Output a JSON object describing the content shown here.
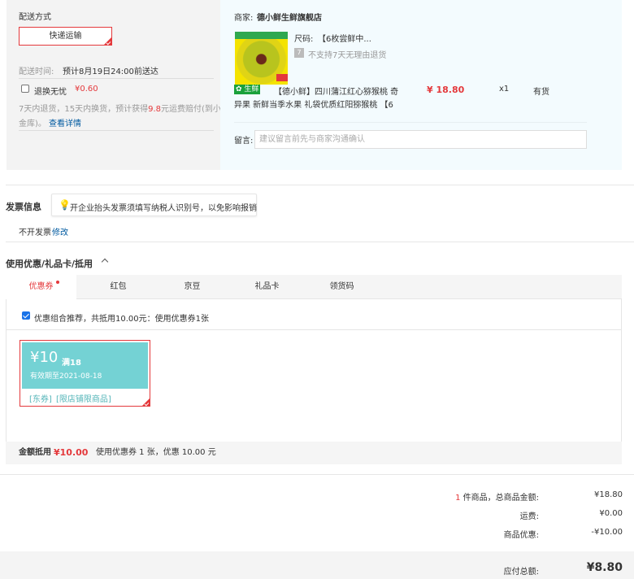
{
  "shipping": {
    "title": "配送方式",
    "method_label": "快递运输",
    "time_label": "配送时间:",
    "time_value": "预计8月19日24:00前送达",
    "worry_free_label": "退换无忧",
    "worry_free_price": "¥0.60",
    "worry_free_desc_1": "7天内退货，15天内换货，预计获得",
    "worry_free_desc_highlight": "9.8",
    "worry_free_desc_2": "元运费赔付(到小",
    "worry_free_desc_3": "金库)。",
    "view_details": "查看详情"
  },
  "shop": {
    "merchant_label": "商家:",
    "merchant_name": "德小鲜生鲜旗舰店",
    "size_label": "尺码:",
    "size_value": "【6枚尝鲜中...",
    "no_return_badge": "7",
    "no_return_text": "不支持7天无理由退货",
    "badge": "生鲜",
    "product_title_1": "【德小鲜】四川蒲江红心猕猴桃 奇",
    "product_title_2": "异果 新鲜当季水果 礼袋优质红阳猕猴桃 【6",
    "price": "¥ 18.80",
    "quantity": "x1",
    "stock": "有货",
    "note_label": "留言:",
    "note_placeholder": "建议留言前先与商家沟通确认"
  },
  "invoice": {
    "title": "发票信息",
    "tip": "开企业抬头发票须填写纳税人识别号，以免影响报销",
    "status": "不开发票",
    "modify": "修改"
  },
  "discount": {
    "title": "使用优惠/礼品卡/抵用",
    "tabs": [
      "优惠券",
      "红包",
      "京豆",
      "礼品卡",
      "领货码"
    ],
    "combo_text": "优惠组合推荐，共抵用10.00元：使用优惠券1张",
    "coupon": {
      "amount": "¥10",
      "condition": "满18",
      "validity": "有效期至2021-08-18",
      "tag1": "[东券]",
      "tag2": "[限店铺限商品]"
    },
    "deduct_label": "金额抵用",
    "deduct_value": "¥10.00",
    "deduct_desc": "使用优惠券 1 张，优惠 10.00 元"
  },
  "summary": {
    "count": "1",
    "goods_label": "件商品，总商品金额:",
    "goods_value": "¥18.80",
    "freight_label": "运费:",
    "freight_value": "¥0.00",
    "discount_label": "商品优惠:",
    "discount_value": "-¥10.00",
    "total_label": "应付总额:",
    "total_value": "¥8.80"
  },
  "colors": {
    "accent": "#e4393c",
    "coupon": "#74d2d4",
    "link": "#005aa0"
  }
}
